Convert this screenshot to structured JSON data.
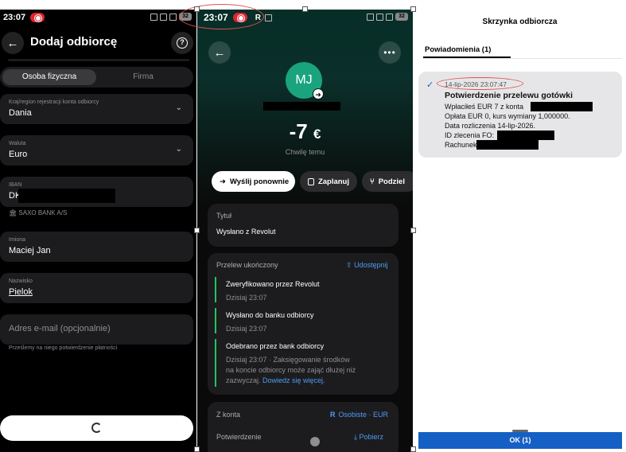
{
  "panel1": {
    "status_time": "23:07",
    "status_battery": "32",
    "title": "Dodaj odbiorcę",
    "help_icon": "question-circle-icon",
    "tabs": [
      "Osoba fizyczna",
      "Firma"
    ],
    "fields": {
      "country": {
        "label": "Kraj/region rejestracji konta odbiorcy",
        "value": "Dania"
      },
      "currency": {
        "label": "Waluta",
        "value": "Euro"
      },
      "iban": {
        "label": "IBAN",
        "value": "DK"
      },
      "first_name": {
        "label": "Imiona",
        "value": "Maciej Jan"
      },
      "last_name": {
        "label": "Nazwisko",
        "value": "Pielok"
      },
      "email": {
        "placeholder": "Adres e-mail (opcjonalnie)"
      }
    },
    "bank_name": "SAXO BANK A/S",
    "email_note": "Prześlemy na niego potwierdzenie płatności"
  },
  "panel2": {
    "status_time": "23:07",
    "status_battery": "32",
    "avatar_initials": "MJ",
    "amount": "-7",
    "currency_symbol": "€",
    "time_ago": "Chwilę temu",
    "actions": [
      "Wyślij ponownie",
      "Zaplanuj",
      "Podziel"
    ],
    "title_card": {
      "label": "Tytuł",
      "value": "Wysłano z Revolut"
    },
    "transfer_card": {
      "header": "Przelew ukończony",
      "share_label": "Udostępnij",
      "steps": [
        {
          "title": "Zweryfikowano przez Revolut",
          "time": "Dzisiaj 23:07"
        },
        {
          "title": "Wysłano do banku odbiorcy",
          "time": "Dzisiaj 23:07"
        },
        {
          "title": "Odebrano przez bank odbiorcy",
          "time_line1": "Dzisiaj 23:07 · Zaksięgowanie środków",
          "time_line2": "na koncie odbiorcy może zająć dłużej niż",
          "time_line3": "zazwyczaj.",
          "learn_more": "Dowiedz się więcej."
        }
      ]
    },
    "from_account": {
      "label": "Z konta",
      "value": "Osobiste · EUR"
    },
    "confirmation": {
      "label": "Potwierdzenie",
      "action": "Pobierz"
    }
  },
  "panel3": {
    "title": "Skrzynka odbiorcza",
    "tab": "Powiadomienia (1)",
    "notification": {
      "timestamp": "14-lip-2026 23:07:47",
      "title": "Potwierdzenie przelewu gotówki",
      "line1": "Wpłaciłeś EUR 7 z konta",
      "line2": "Opłata EUR 0, kurs wymiany 1,000000.",
      "line3": "Data rozliczenia 14-lip-2026.",
      "line4": "ID zlecenia FO:",
      "line5": "Rachunek:"
    },
    "ok_button": "OK (1)"
  },
  "colors": {
    "revolut_green": "#1aa37f",
    "link_blue": "#4f9cf5",
    "ok_blue": "#1560c4",
    "record_red": "#e0242f",
    "annotation_red": "#e05050"
  }
}
